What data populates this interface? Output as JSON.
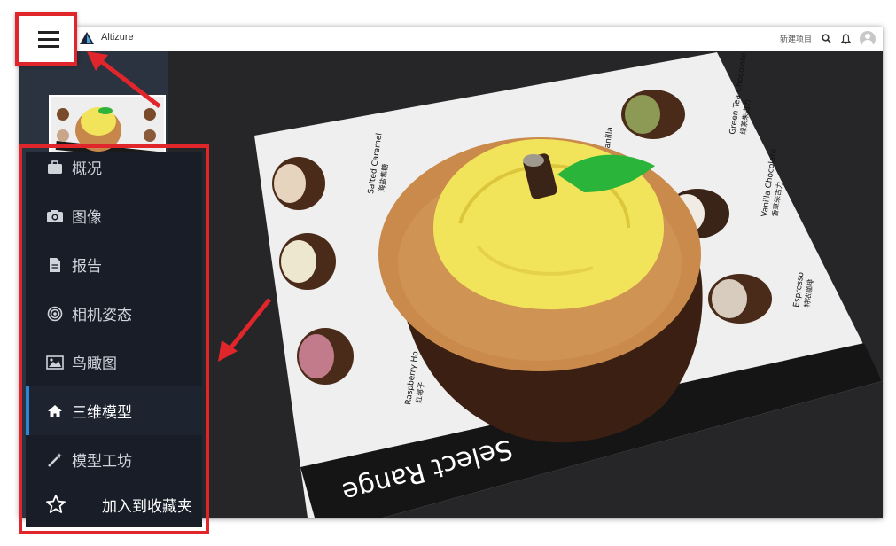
{
  "app": {
    "brand_name": "Altizure",
    "new_project_label": "新建项目",
    "icons": [
      "logo-icon",
      "search-icon",
      "bell-icon",
      "avatar-icon",
      "hamburger-icon"
    ]
  },
  "menu": {
    "items": [
      {
        "label": "概况",
        "icon": "briefcase-icon",
        "active": false
      },
      {
        "label": "图像",
        "icon": "camera-icon",
        "active": false
      },
      {
        "label": "报告",
        "icon": "document-icon",
        "active": false
      },
      {
        "label": "相机姿态",
        "icon": "target-icon",
        "active": false
      },
      {
        "label": "鸟瞰图",
        "icon": "image-icon",
        "active": false
      },
      {
        "label": "三维模型",
        "icon": "home-icon",
        "active": true
      },
      {
        "label": "模型工坊",
        "icon": "magic-wand-icon",
        "active": false
      }
    ],
    "favorite_label": "加入到收藏夹",
    "favorite_icon": "star-icon"
  },
  "viewer": {
    "paper_text": "Select Range",
    "cupcake_labels": [
      {
        "en": "Salted Caramel",
        "zh": "海盐焦糖"
      },
      {
        "en": "Green Tea Chocolate",
        "zh": "绿茶朱古力"
      },
      {
        "en": "Vanilla Chocolate",
        "zh": "香草朱古力"
      },
      {
        "en": "Espresso",
        "zh": "特浓咖啡"
      },
      {
        "en": "Raspberry Ho",
        "zh": "红莓子"
      },
      {
        "en": "Vanilla",
        "zh": ""
      }
    ]
  },
  "colors": {
    "highlight_red": "#e0262b",
    "menu_bg": "#181d27",
    "active_accent": "#2f86d6",
    "viewer_bg": "#262628",
    "frosting_yellow": "#f2e45a"
  }
}
